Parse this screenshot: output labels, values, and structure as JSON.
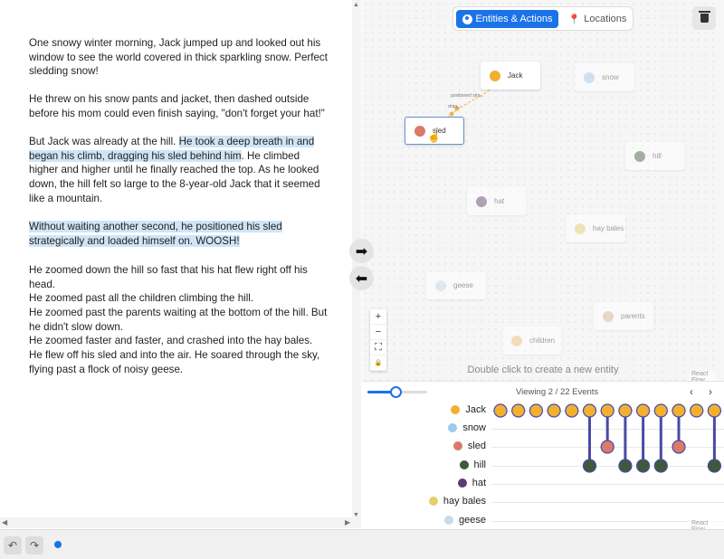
{
  "colors": {
    "accent": "#1a73e8",
    "highlight": "#cfe5f7",
    "connector": "#4a4aa8",
    "jack": "#f2b030",
    "sled": "#d97a6a",
    "hill": "#3f5a3a",
    "snow": "#9cc9ee",
    "hat": "#5e3b6f",
    "hay": "#e6cf6a",
    "geese": "#c9dbe8",
    "parents": "#d7b98a",
    "children": "#efc27a"
  },
  "story": {
    "paragraphs": [
      {
        "segments": [
          {
            "text": "One snowy winter morning, Jack jumped up and looked out his window to see the world covered in thick sparkling snow. Perfect sledding snow!",
            "highlight": false
          }
        ]
      },
      {
        "segments": [
          {
            "text": "He threw on his snow pants and jacket, then dashed outside before his mom could even finish saying, \"don't forget your hat!\"",
            "highlight": false
          }
        ]
      },
      {
        "segments": [
          {
            "text": "But Jack was already at the hill. ",
            "highlight": false
          },
          {
            "text": "He took a deep breath in and began his climb, dragging his sled behind him",
            "highlight": true
          },
          {
            "text": ". He climbed higher and higher until he finally reached the top. As he looked down, the hill felt so large to the 8-year-old Jack that it seemed like a mountain.",
            "highlight": false
          }
        ]
      },
      {
        "segments": [
          {
            "text": "Without waiting another second, he positioned his sled strategically and loaded himself on. WOOSH!",
            "highlight": true
          }
        ]
      },
      {
        "segments": [
          {
            "text": "He zoomed down the hill so fast that his hat flew right off his head.",
            "highlight": false
          }
        ]
      },
      {
        "segments": [
          {
            "text": "He zoomed past all the children climbing the hill.",
            "highlight": false
          }
        ]
      },
      {
        "segments": [
          {
            "text": "He zoomed past the parents waiting at the bottom of the hill. But he didn't slow down.",
            "highlight": false
          }
        ]
      },
      {
        "segments": [
          {
            "text": "He zoomed faster and faster, and crashed into the hay bales.",
            "highlight": false
          }
        ]
      },
      {
        "segments": [
          {
            "text": "He flew off his sled and into the air. He soared through the sky, flying past a flock of noisy geese.",
            "highlight": false
          }
        ]
      }
    ]
  },
  "toolbar": {
    "undo_icon": "undo-arrow-icon",
    "redo_icon": "redo-arrow-icon",
    "next_icon": "arrow-right-icon",
    "prev_icon": "arrow-left-icon"
  },
  "graph": {
    "tabs": [
      {
        "label": "Entities & Actions",
        "icon": "user-circle-icon",
        "active": true
      },
      {
        "label": "Locations",
        "icon": "map-pin-icon",
        "active": false
      }
    ],
    "delete_icon": "trash-icon",
    "nodes": [
      {
        "id": "jack",
        "label": "Jack",
        "faded": false,
        "selected": false
      },
      {
        "id": "snow",
        "label": "snow",
        "faded": true,
        "selected": false
      },
      {
        "id": "sled",
        "label": "sled",
        "faded": false,
        "selected": true
      },
      {
        "id": "hill",
        "label": "hill",
        "faded": true,
        "selected": false
      },
      {
        "id": "hat",
        "label": "hat",
        "faded": true,
        "selected": false
      },
      {
        "id": "hay",
        "label": "hay bales",
        "faded": true,
        "selected": false
      },
      {
        "id": "geese",
        "label": "geese",
        "faded": true,
        "selected": false
      },
      {
        "id": "parents",
        "label": "parents",
        "faded": true,
        "selected": false
      },
      {
        "id": "children",
        "label": "children",
        "faded": true,
        "selected": false
      }
    ],
    "edge_label_1": "positioned stra...",
    "edge_label_2": "drag...",
    "zoom_in": "+",
    "zoom_out": "−",
    "fit_view": "⛶",
    "lock": "🔒",
    "hint": "Double click to create a new entity",
    "attribution": "React Flow"
  },
  "timeline": {
    "viewing_label": "Viewing 2 / 22 Events",
    "zoom_level": 0.5,
    "prev_label": "‹",
    "next_label": "›",
    "attribution": "React Flow",
    "rows": [
      {
        "label": "Jack",
        "icon": "face-icon"
      },
      {
        "label": "snow",
        "icon": "snowflake-icon"
      },
      {
        "label": "sled",
        "icon": "sled-icon"
      },
      {
        "label": "hill",
        "icon": "mountain-icon"
      },
      {
        "label": "hat",
        "icon": "top-hat-icon"
      },
      {
        "label": "hay bales",
        "icon": "hay-icon"
      },
      {
        "label": "geese",
        "icon": "goose-icon"
      }
    ],
    "events": [
      {
        "rows": [
          "Jack"
        ]
      },
      {
        "rows": [
          "Jack"
        ]
      },
      {
        "rows": [
          "Jack"
        ]
      },
      {
        "rows": [
          "Jack"
        ]
      },
      {
        "rows": [
          "Jack"
        ]
      },
      {
        "rows": [
          "Jack",
          "hill"
        ]
      },
      {
        "rows": [
          "Jack",
          "sled"
        ]
      },
      {
        "rows": [
          "Jack",
          "hill"
        ]
      },
      {
        "rows": [
          "Jack",
          "hill"
        ]
      },
      {
        "rows": [
          "Jack",
          "hill"
        ]
      },
      {
        "rows": [
          "Jack",
          "sled"
        ]
      },
      {
        "rows": [
          "Jack"
        ]
      },
      {
        "rows": [
          "Jack",
          "hill"
        ]
      }
    ]
  }
}
